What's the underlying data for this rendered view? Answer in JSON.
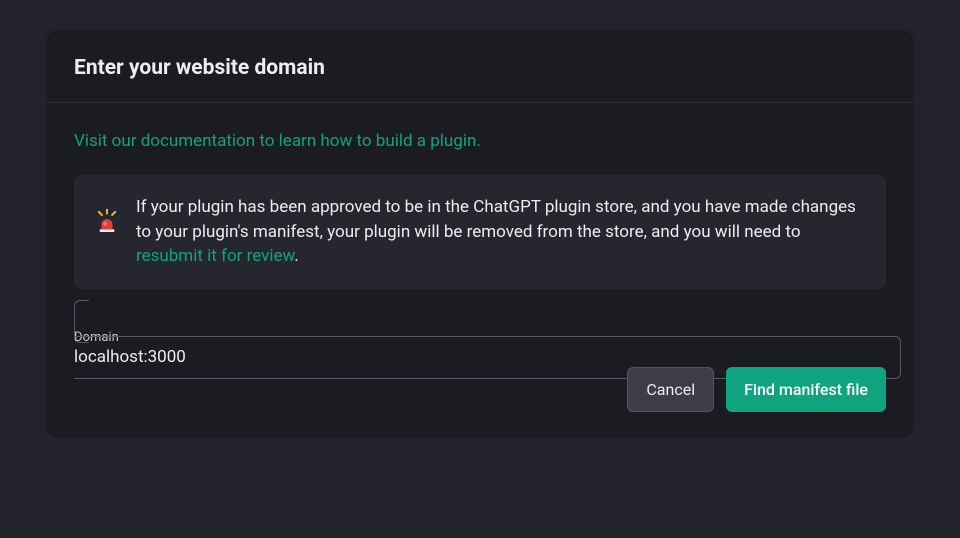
{
  "modal": {
    "title": "Enter your website domain",
    "doc_link": "Visit our documentation to learn how to build a plugin.",
    "warning": {
      "icon": "siren-icon",
      "text_before": "If your plugin has been approved to be in the ChatGPT plugin store, and you have made changes to your plugin's manifest, your plugin will be removed from the store, and you will need to ",
      "link": "resubmit it for review",
      "text_after": "."
    },
    "input": {
      "label": "Domain",
      "value": "localhost:3000"
    },
    "buttons": {
      "cancel": "Cancel",
      "submit": "Find manifest file"
    }
  },
  "colors": {
    "accent": "#10a37f",
    "bg": "#23232d",
    "panel": "#1b1b22"
  }
}
